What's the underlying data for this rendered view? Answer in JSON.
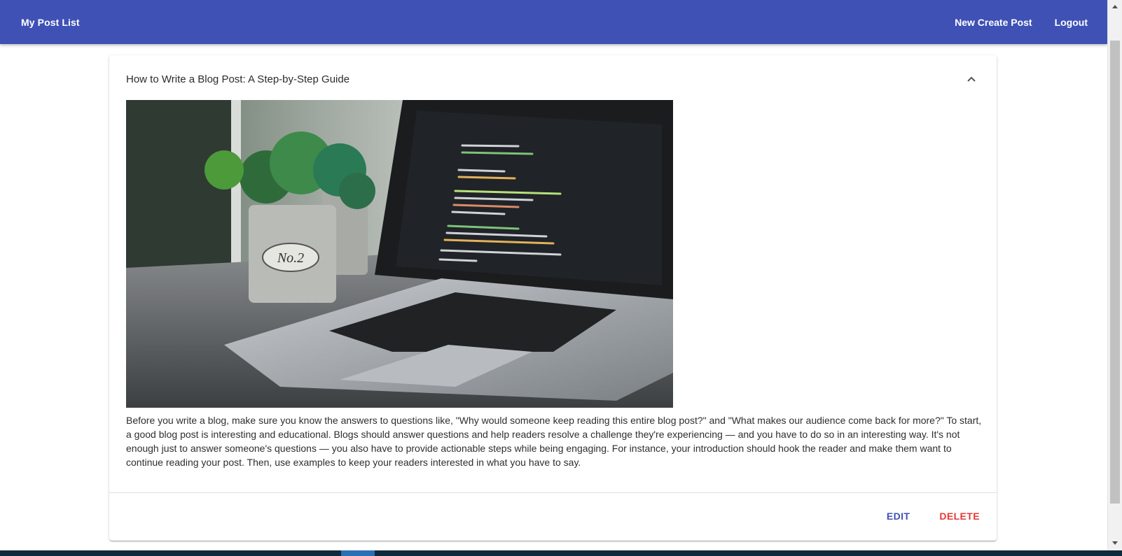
{
  "app_bar": {
    "brand": "My Post List",
    "new_post_label": "New Create Post",
    "logout_label": "Logout",
    "color": "#3f51b5"
  },
  "post": {
    "title": "How to Write a Blog Post: A Step-by-Step Guide",
    "image_alt": "Laptop with code editor next to potted plant labeled No. 2",
    "image_label": "No.2",
    "body": "Before you write a blog, make sure you know the answers to questions like, \"Why would someone keep reading this entire blog post?\" and \"What makes our audience come back for more?\" To start, a good blog post is interesting and educational. Blogs should answer questions and help readers resolve a challenge they're experiencing — and you have to do so in an interesting way. It's not enough just to answer someone's questions — you also have to provide actionable steps while being engaging. For instance, your introduction should hook the reader and make them want to continue reading your post. Then, use examples to keep your readers interested in what you have to say.",
    "expanded": true,
    "actions": {
      "edit_label": "EDIT",
      "delete_label": "DELETE",
      "edit_color": "#3f51b5",
      "delete_color": "#e53935"
    }
  },
  "icons": {
    "collapse": "chevron-up-icon"
  }
}
